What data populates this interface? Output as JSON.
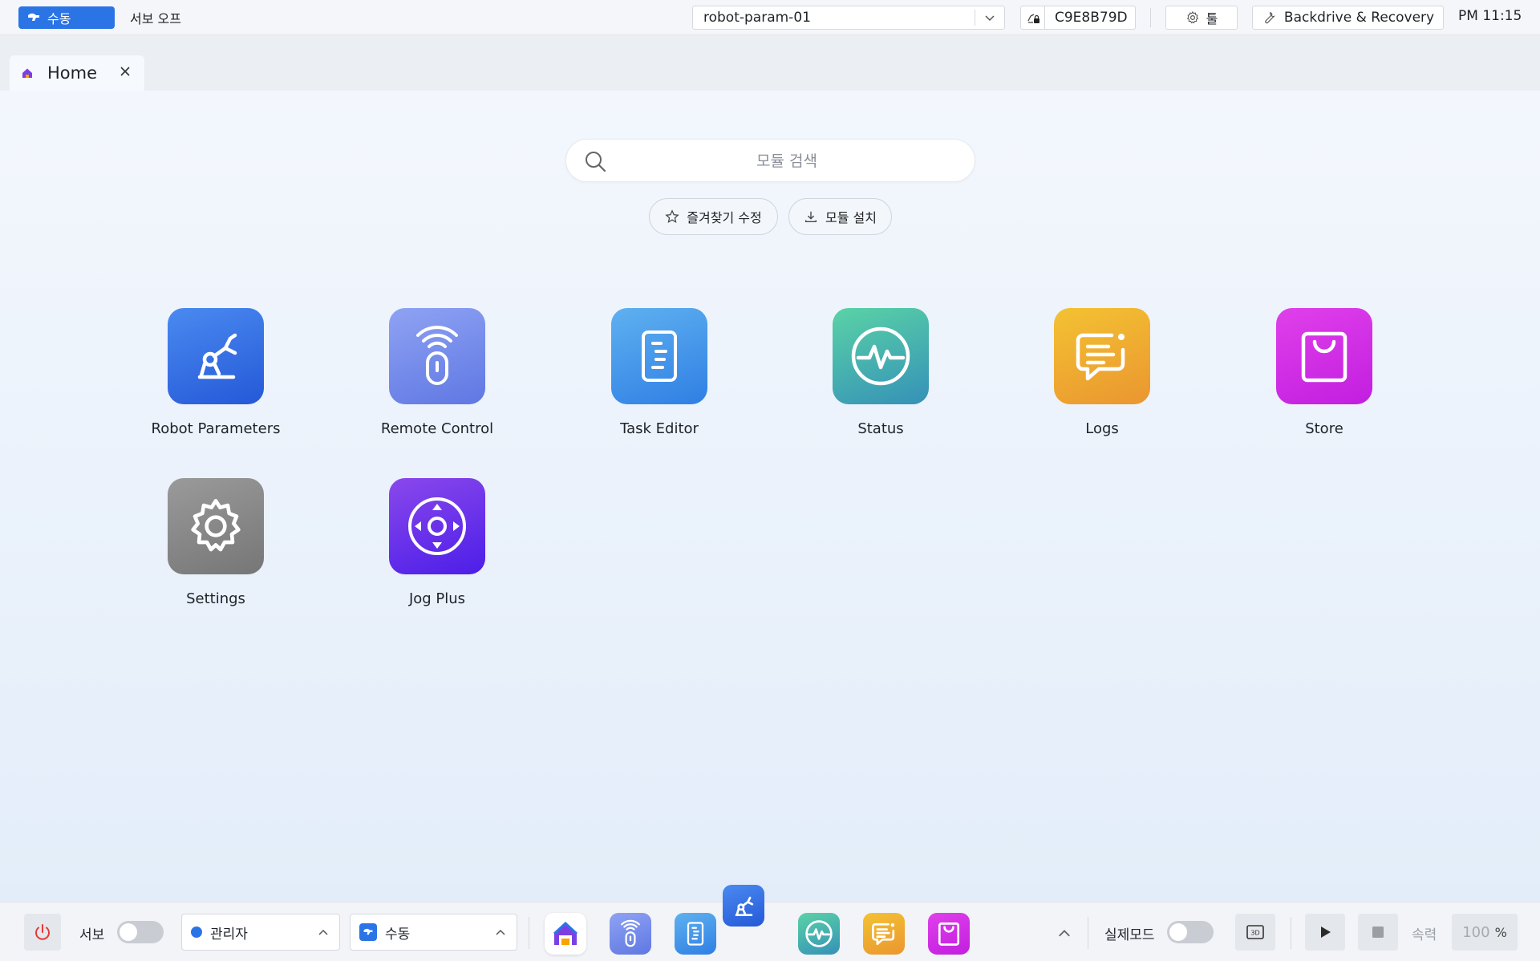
{
  "topbar": {
    "mode_label": "수동",
    "servo_status": "서보 오프",
    "robot_select_value": "robot-param-01",
    "serial": "C9E8B79D",
    "tool_label": "툴",
    "backdrive_label": "Backdrive & Recovery",
    "clock": "PM 11:15"
  },
  "tabs": [
    {
      "label": "Home"
    }
  ],
  "search": {
    "placeholder": "모듈 검색",
    "value": ""
  },
  "actions": {
    "favorites_label": "즐겨찾기 수정",
    "install_label": "모듈 설치"
  },
  "apps": [
    {
      "label": "Robot Parameters",
      "icon": "robot-arm-icon",
      "color": "#2e6ae3"
    },
    {
      "label": "Remote Control",
      "icon": "remote-icon",
      "color": "#6f86e8"
    },
    {
      "label": "Task Editor",
      "icon": "document-icon",
      "color": "#3b8fe6"
    },
    {
      "label": "Status",
      "icon": "pulse-icon",
      "color": "#3aa6a8"
    },
    {
      "label": "Logs",
      "icon": "chat-log-icon",
      "color": "#efae2d"
    },
    {
      "label": "Store",
      "icon": "shopping-bag-icon",
      "color": "#cc2de8"
    },
    {
      "label": "Settings",
      "icon": "gear-icon",
      "color": "#8a8a8a"
    },
    {
      "label": "Jog Plus",
      "icon": "joystick-icon",
      "color": "#6a2ff0"
    }
  ],
  "bottombar": {
    "servo_label": "서보",
    "servo_on": false,
    "role_value": "관리자",
    "mode_value": "수동",
    "real_mode_label": "실제모드",
    "real_mode_on": false,
    "view_3d_label": "3D",
    "speed_label": "속력",
    "speed_value": "100",
    "speed_unit": "%"
  },
  "colors": {
    "accent": "#2b74e6",
    "power_icon": "#e53935"
  }
}
